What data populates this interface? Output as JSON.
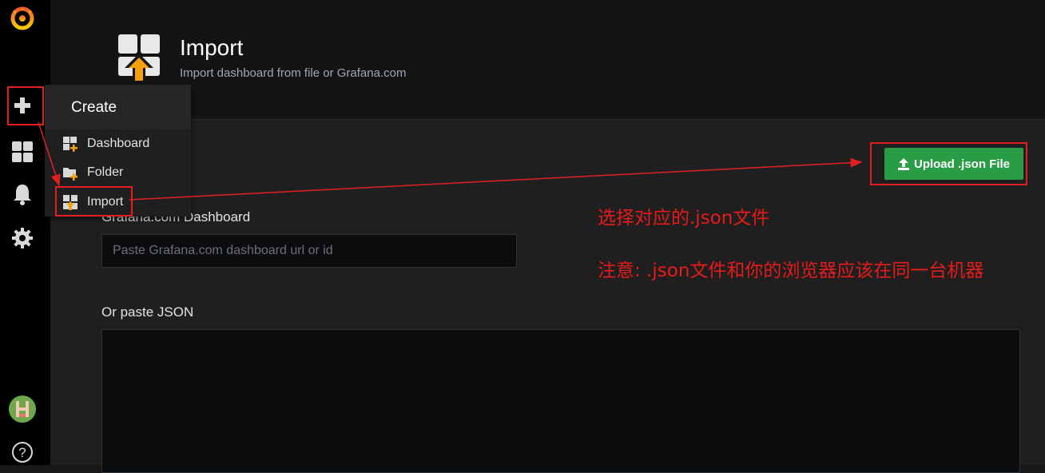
{
  "page": {
    "title": "Import",
    "subtitle": "Import dashboard from file or Grafana.com"
  },
  "sidemenu": {
    "icons": [
      "grafana-logo",
      "plus-icon",
      "dashboards-icon",
      "bell-icon",
      "gear-icon",
      "avatar",
      "help-icon"
    ]
  },
  "create_menu": {
    "title": "Create",
    "items": [
      {
        "label": "Dashboard",
        "icon": "dashboard-add-icon"
      },
      {
        "label": "Folder",
        "icon": "folder-add-icon"
      },
      {
        "label": "Import",
        "icon": "import-icon"
      }
    ]
  },
  "upload": {
    "label": "Upload .json File",
    "icon": "upload-icon",
    "color": "#299c46"
  },
  "grafana_com": {
    "label": "Grafana.com Dashboard",
    "placeholder": "Paste Grafana.com dashboard url or id",
    "value": ""
  },
  "json_paste": {
    "label": "Or paste JSON",
    "value": ""
  },
  "annotations": {
    "line1": "选择对应的.json文件",
    "line2": "注意: .json文件和你的浏览器应该在同一台机器",
    "color": "#e81a1a"
  }
}
